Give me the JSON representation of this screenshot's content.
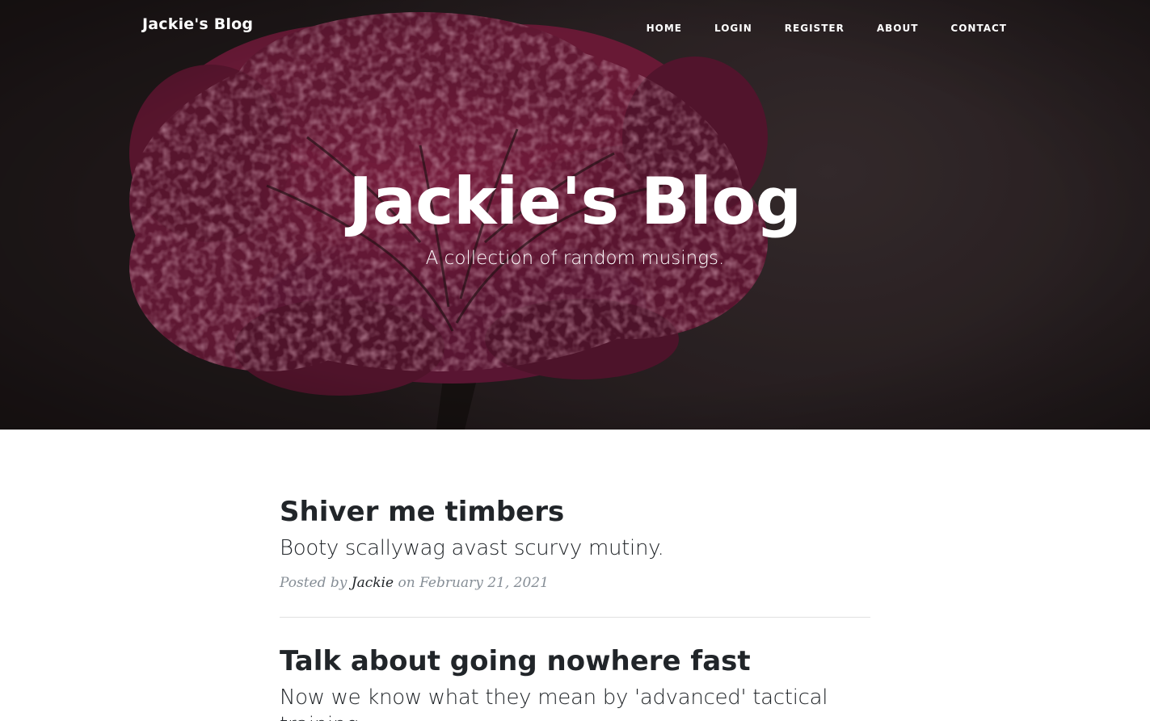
{
  "navbar": {
    "brand": "Jackie's Blog",
    "links": [
      {
        "label": "HOME"
      },
      {
        "label": "LOGIN"
      },
      {
        "label": "REGISTER"
      },
      {
        "label": "ABOUT"
      },
      {
        "label": "CONTACT"
      }
    ]
  },
  "hero": {
    "title": "Jackie's Blog",
    "subtitle": "A collection of random musings.",
    "accent_color": "#8c1f45",
    "background_color": "#2b2224"
  },
  "posts": [
    {
      "title": "Shiver me timbers",
      "subtitle": "Booty scallywag avast scurvy mutiny.",
      "meta_prefix": "Posted by",
      "author": "Jackie",
      "meta_on": "on",
      "date": "February 21, 2021"
    },
    {
      "title": "Talk about going nowhere fast",
      "subtitle": "Now we know what they mean by 'advanced' tactical training."
    }
  ]
}
